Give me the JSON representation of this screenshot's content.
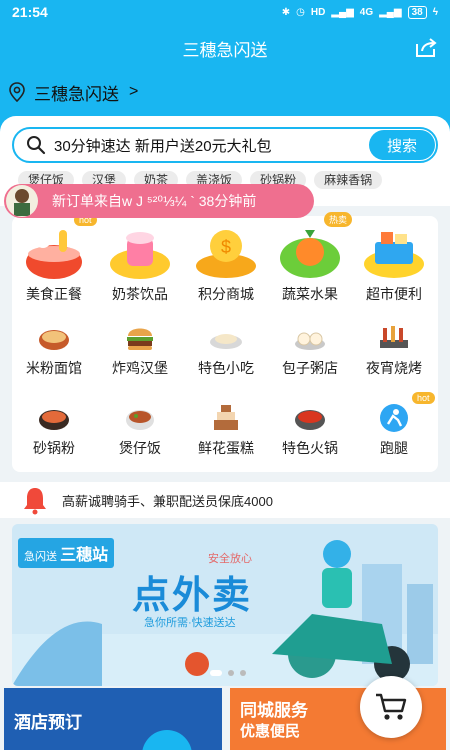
{
  "statusbar": {
    "time": "21:54",
    "net1": "HD",
    "net2": "4G",
    "battery": "38"
  },
  "header": {
    "title": "三穗急闪送"
  },
  "location": {
    "name": "三穗急闪送"
  },
  "search": {
    "placeholder": "30分钟速达 新用户送20元大礼包",
    "button": "搜索"
  },
  "hot_tags": [
    "煲仔饭",
    "汉堡",
    "奶茶",
    "盖浇饭",
    "砂锅粉",
    "麻辣香锅"
  ],
  "toast": {
    "text": "新订单来自w J ⁵²⁰⅓¼ ` 38分钟前"
  },
  "categories_big": [
    {
      "label": "美食正餐",
      "badge": "hot"
    },
    {
      "label": "奶茶饮品"
    },
    {
      "label": "积分商城"
    },
    {
      "label": "蔬菜水果",
      "badge": "热卖"
    },
    {
      "label": "超市便利"
    }
  ],
  "categories_small_row1": [
    {
      "label": "米粉面馆"
    },
    {
      "label": "炸鸡汉堡"
    },
    {
      "label": "特色小吃"
    },
    {
      "label": "包子粥店"
    },
    {
      "label": "夜宵烧烤"
    }
  ],
  "categories_small_row2": [
    {
      "label": "砂锅粉"
    },
    {
      "label": "煲仔饭"
    },
    {
      "label": "鲜花蛋糕"
    },
    {
      "label": "特色火锅"
    },
    {
      "label": "跑腿",
      "badge": "hot"
    }
  ],
  "notice": {
    "text": "高薪诚聘骑手、兼职配送员保底4000"
  },
  "banner": {
    "brand_prefix": "急闪送",
    "brand": "三穗站",
    "small_text": "安全放心",
    "slogan": "点外卖",
    "sub": "急你所需·快速送达"
  },
  "promos": [
    {
      "title": "酒店预订"
    },
    {
      "title": "同城服务",
      "subtitle": "优惠便民"
    }
  ],
  "colors": {
    "primary": "#19b6f1",
    "toast": "#ef6f8f",
    "badge": "#f7b62d"
  }
}
